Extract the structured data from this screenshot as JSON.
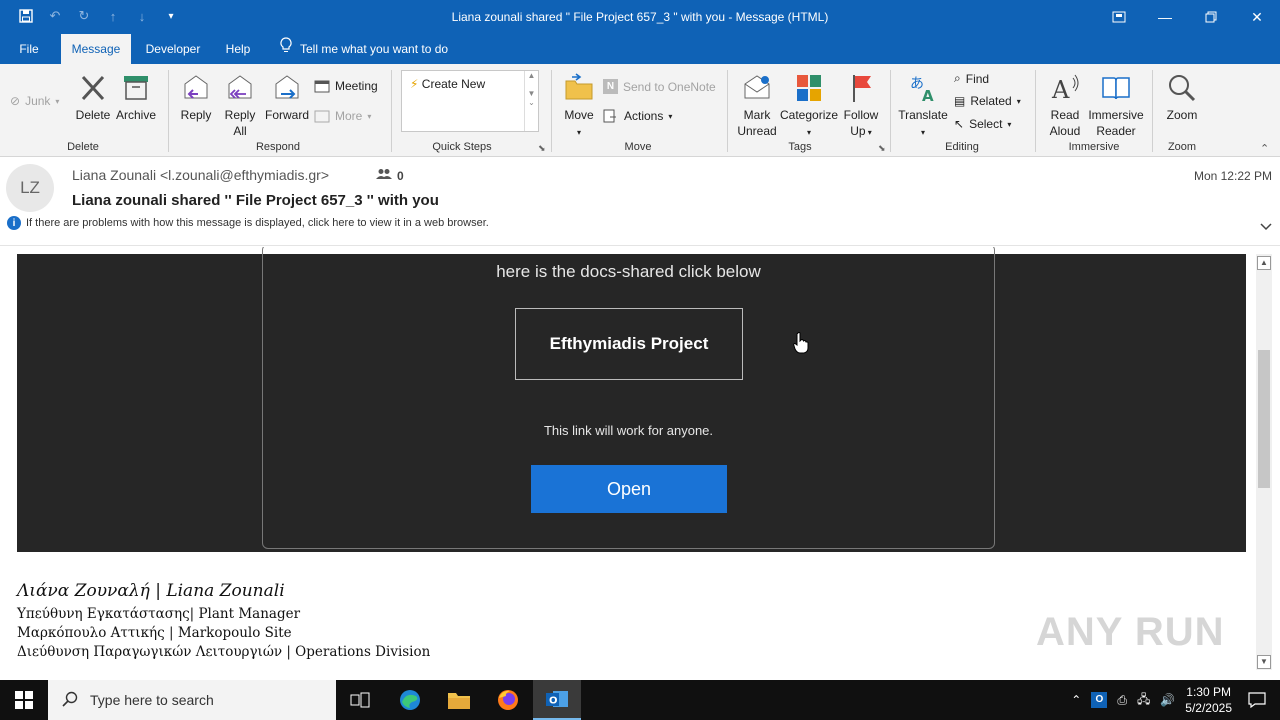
{
  "window": {
    "title": "Liana zounali shared \" File Project 657_3 \" with you  -  Message (HTML)"
  },
  "tabs": [
    {
      "label": "File"
    },
    {
      "label": "Message"
    },
    {
      "label": "Developer"
    },
    {
      "label": "Help"
    }
  ],
  "tell_me": "Tell me what you want to do",
  "ribbon": {
    "junk": "Junk",
    "delete": "Delete",
    "archive": "Archive",
    "reply": "Reply",
    "reply_all_1": "Reply",
    "reply_all_2": "All",
    "forward": "Forward",
    "meeting": "Meeting",
    "more": "More",
    "create_new": "Create New",
    "move": "Move",
    "send_onenote": "Send to OneNote",
    "actions": "Actions",
    "mark_unread_1": "Mark",
    "mark_unread_2": "Unread",
    "categorize": "Categorize",
    "follow_up_1": "Follow",
    "follow_up_2": "Up",
    "translate": "Translate",
    "find": "Find",
    "related": "Related",
    "select": "Select",
    "read_aloud_1": "Read",
    "read_aloud_2": "Aloud",
    "immersive_1": "Immersive",
    "immersive_2": "Reader",
    "zoom": "Zoom",
    "groups": {
      "delete": "Delete",
      "respond": "Respond",
      "quick_steps": "Quick Steps",
      "move": "Move",
      "tags": "Tags",
      "editing": "Editing",
      "immersive": "Immersive",
      "zoom": "Zoom"
    }
  },
  "message": {
    "avatar_initials": "LZ",
    "sender": "Liana Zounali <l.zounali@efthymiadis.gr>",
    "people_count": "0",
    "subject": "Liana zounali shared '' File Project 657_3 '' with you",
    "date": "Mon 12:22 PM",
    "info": "If there are problems with how this message is displayed, click here to view it in a web browser."
  },
  "body": {
    "intro": "here is the docs-shared click below",
    "project_button": "Efthymiadis Project",
    "link_note": "This link will work for anyone.",
    "open_button": "Open"
  },
  "signature": {
    "name": "Λιάνα Ζουναλή | Liana Zounali",
    "line1": "Υπεύθυνη Εγκατάστασης| Plant Manager",
    "line2": "Μαρκόπουλο Αττικής | Markopoulo Site",
    "line3": "Διεύθυνση Παραγωγικών Λειτουργιών | Operations Division"
  },
  "watermark": "ANY RUN",
  "taskbar": {
    "search_placeholder": "Type here to search",
    "time": "1:30 PM",
    "date": "5/2/2025"
  },
  "colors": {
    "accent": "#0f62b6",
    "open_button": "#1a73d6",
    "panel": "#262626"
  }
}
